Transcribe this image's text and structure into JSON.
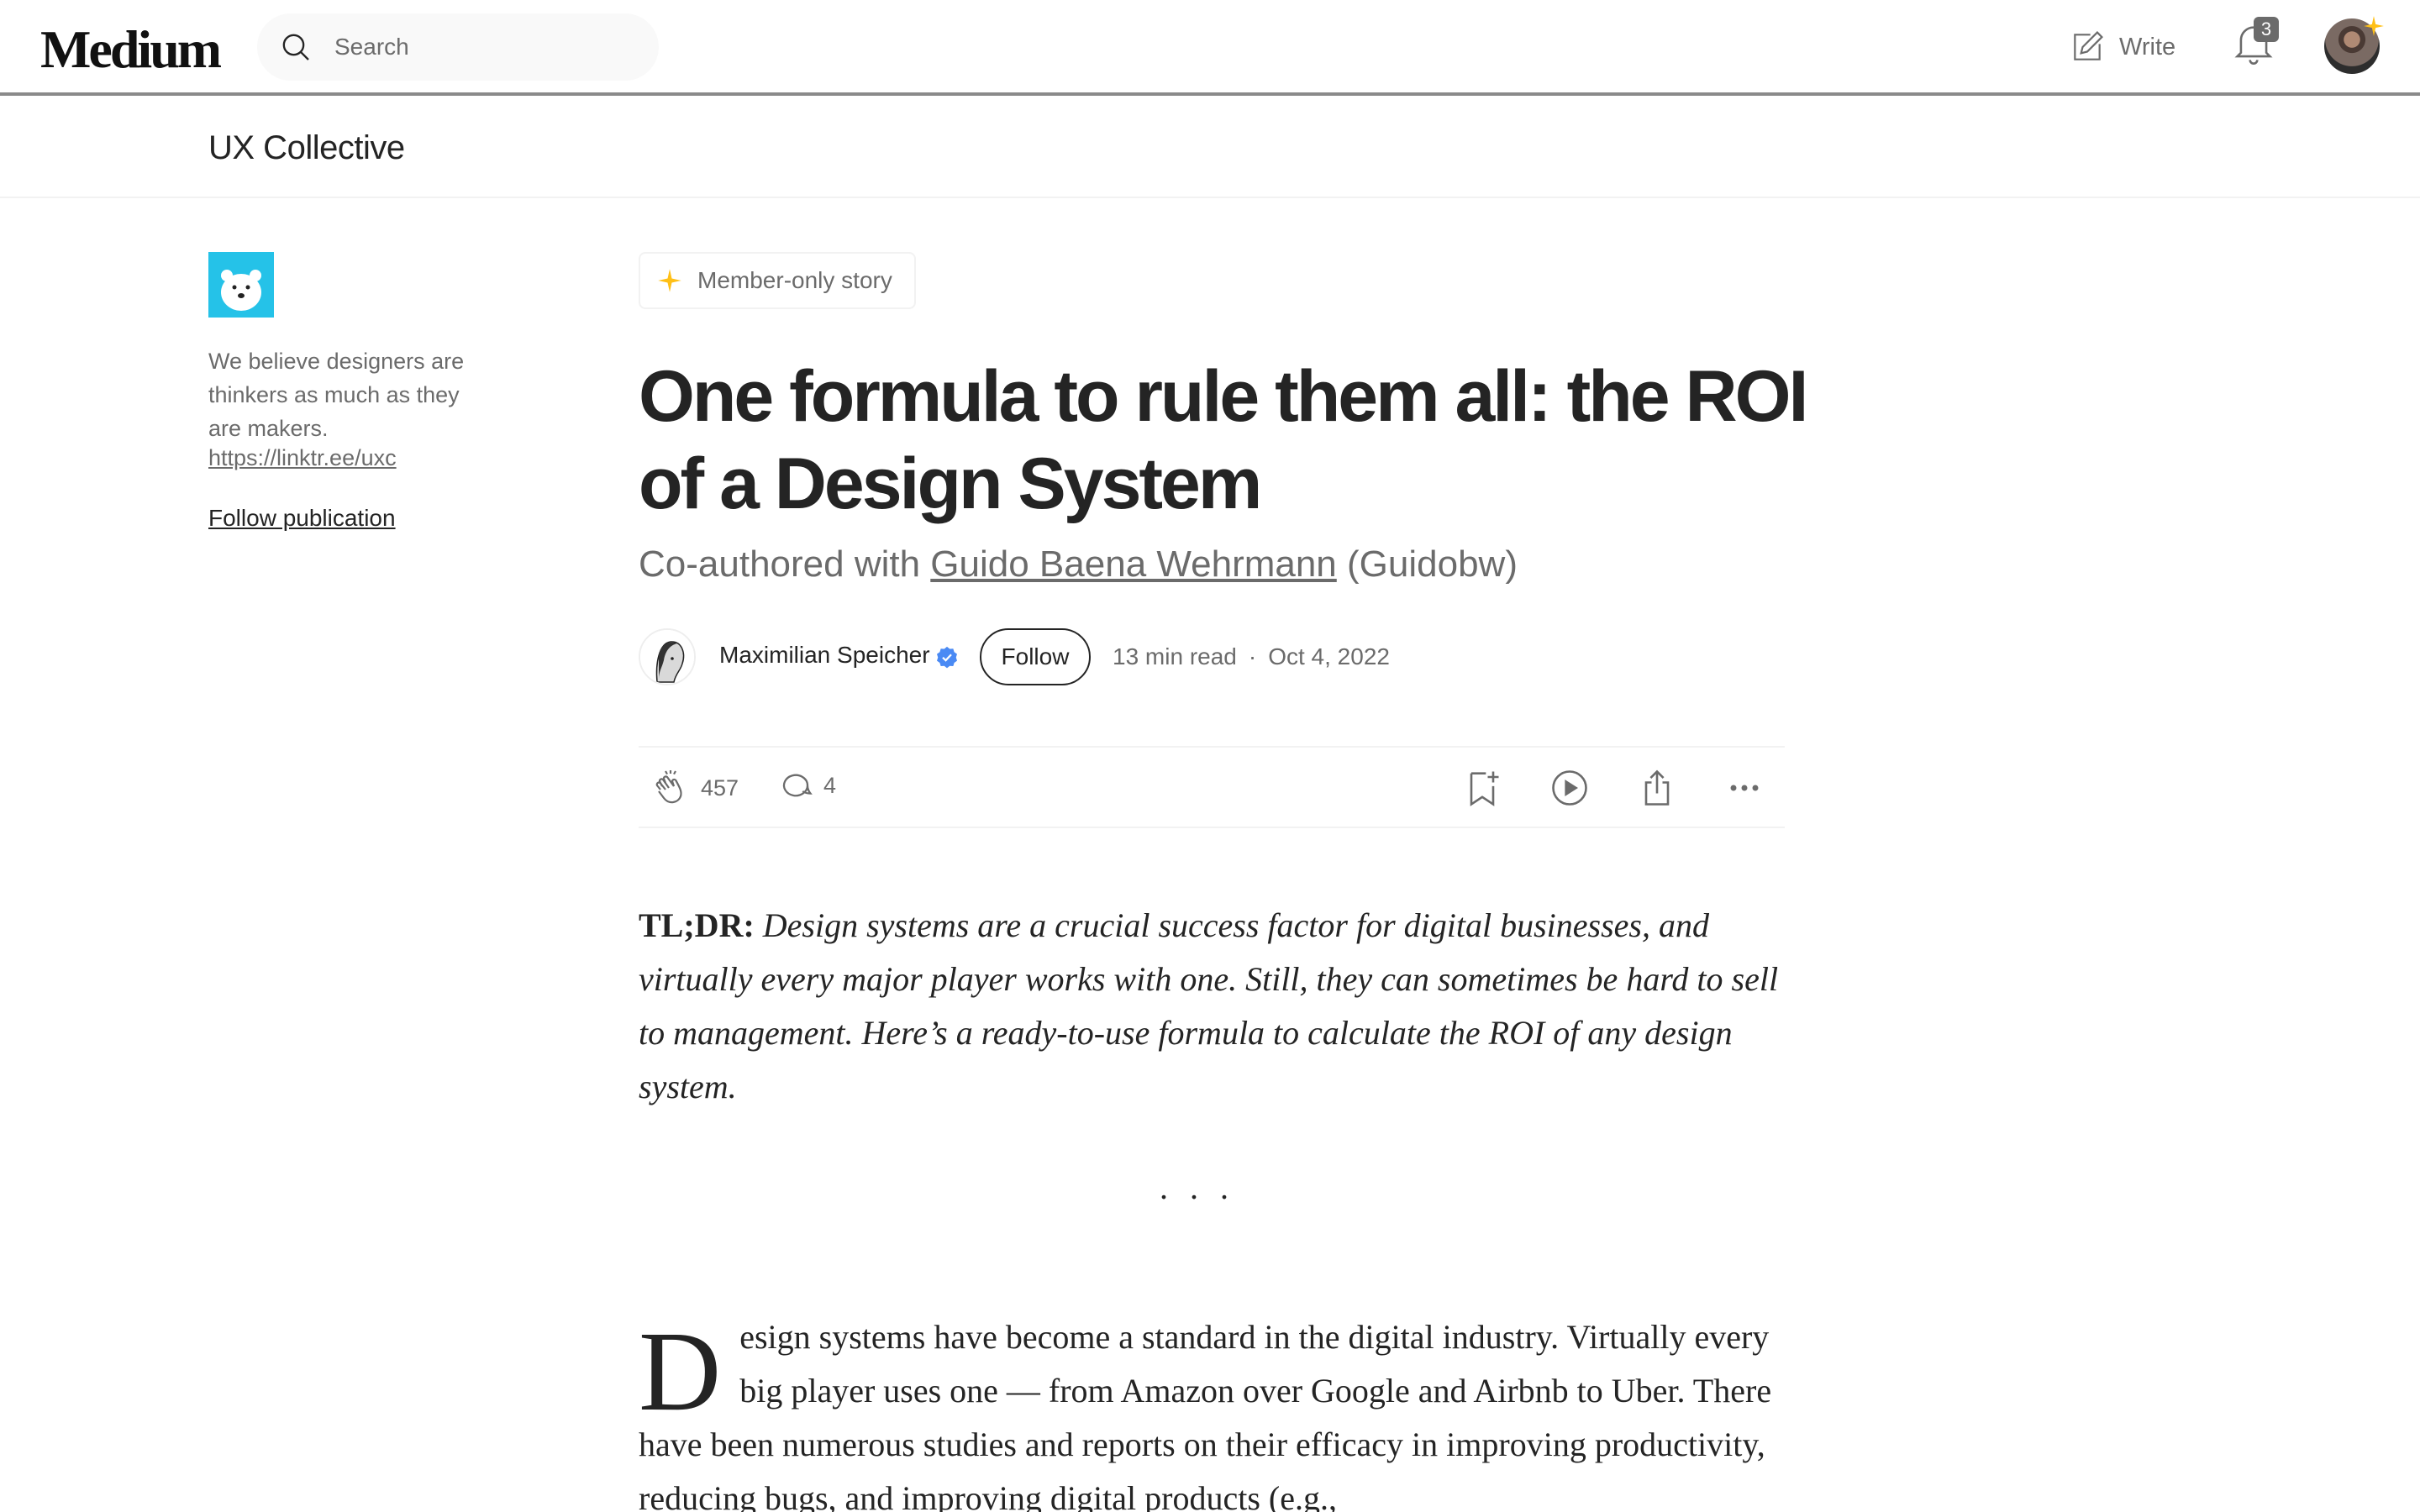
{
  "header": {
    "logo": "Medium",
    "search_placeholder": "Search",
    "write_label": "Write",
    "notification_count": "3"
  },
  "publication": {
    "name": "UX Collective",
    "description": "We believe designers are thinkers as much as they are makers.",
    "link": "https://linktr.ee/uxc",
    "follow_label": "Follow publication"
  },
  "article": {
    "badge": "Member-only story",
    "title": "One formula to rule them all: the ROI of a Design System",
    "subtitle_prefix": "Co-authored with ",
    "subtitle_link": "Guido Baena Wehrmann",
    "subtitle_suffix": " (Guidobw)",
    "author": "Maximilian Speicher",
    "follow_label": "Follow",
    "read_time": "13 min read",
    "date": "Oct 4, 2022",
    "claps": "457",
    "responses": "4",
    "tldr_label": "TL;DR:",
    "tldr_text": "Design systems are a crucial success factor for digital businesses, and virtually every major player works with one. Still, they can sometimes be hard to sell to management. Here’s a ready-to-use formula to calculate the ROI of any design system.",
    "separator": "...",
    "body_dropcap": "D",
    "body_text": "esign systems have become a standard in the digital industry. Virtually every big player uses one — from Amazon over Google and Airbnb to Uber. There have been numerous studies and reports on their efficacy in improving productivity, reducing bugs, and improving digital products (e.g.,"
  },
  "icons": {
    "search": "search-icon",
    "write": "write-icon",
    "bell": "bell-icon",
    "star": "star-icon",
    "clap": "clap-icon",
    "comment": "comment-icon",
    "bookmark": "bookmark-add-icon",
    "play": "play-icon",
    "share": "share-icon",
    "more": "more-icon"
  },
  "colors": {
    "star": "#ffc017",
    "verified": "#4a8af4",
    "text": "#242424",
    "muted": "#6b6b6b"
  }
}
